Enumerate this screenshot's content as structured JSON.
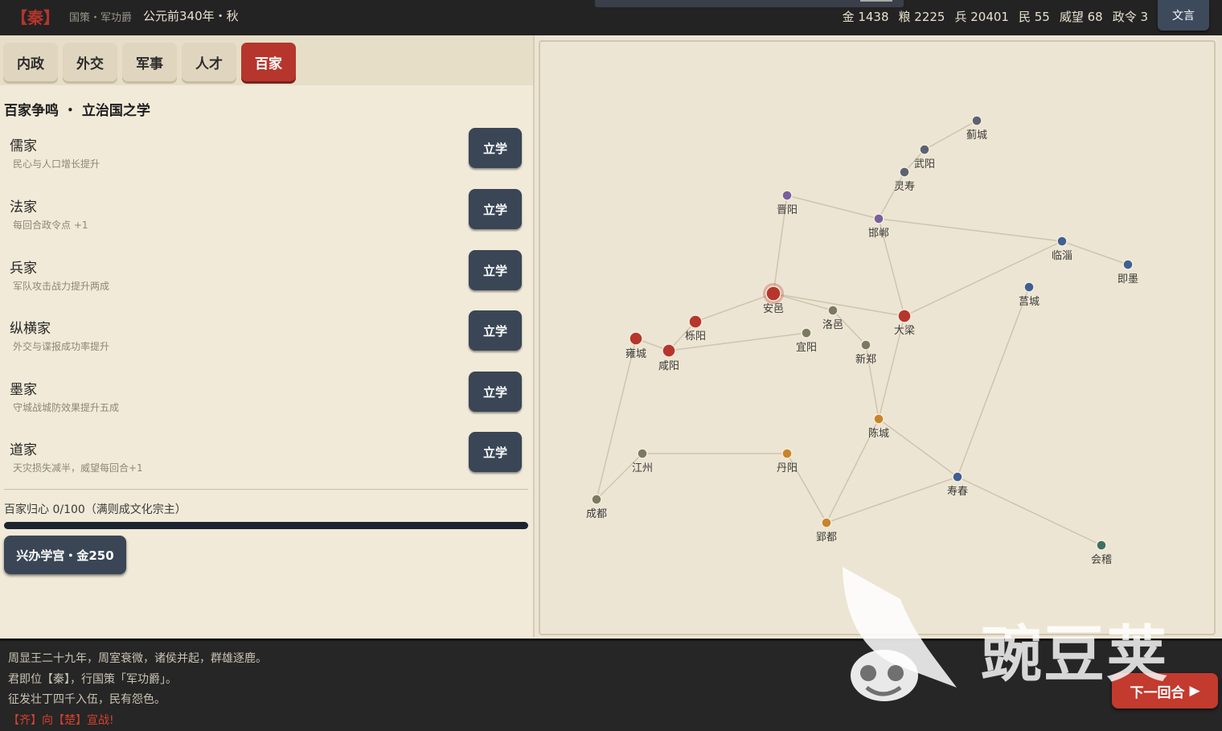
{
  "topbar": {
    "state": "【秦】",
    "policy": "国策・军功爵",
    "date": "公元前340年・秋",
    "stats": [
      "金 1438",
      "粮 2225",
      "兵 20401",
      "民 55",
      "威望 68",
      "政令 3"
    ],
    "wenyan_button": "文言"
  },
  "tabs": [
    {
      "label": "内政",
      "active": false
    },
    {
      "label": "外交",
      "active": false
    },
    {
      "label": "军事",
      "active": false
    },
    {
      "label": "人才",
      "active": false
    },
    {
      "label": "百家",
      "active": true
    }
  ],
  "section_title": "百家争鸣 ・ 立治国之学",
  "schools": [
    {
      "name": "儒家",
      "desc": "民心与人口增长提升",
      "button": "立学"
    },
    {
      "name": "法家",
      "desc": "每回合政令点 +1",
      "button": "立学"
    },
    {
      "name": "兵家",
      "desc": "军队攻击战力提升两成",
      "button": "立学"
    },
    {
      "name": "纵横家",
      "desc": "外交与谍报成功率提升",
      "button": "立学"
    },
    {
      "name": "墨家",
      "desc": "守城战城防效果提升五成",
      "button": "立学"
    },
    {
      "name": "道家",
      "desc": "天灾损失减半，威望每回合+1",
      "button": "立学"
    }
  ],
  "progress": {
    "label": "百家归心 0/100（满则成文化宗主）",
    "value": 0,
    "max": 100
  },
  "build_button": "兴办学宫・金250",
  "map": {
    "colors": {
      "qin": "#b6362d",
      "jin": "#7a5fa0",
      "qi": "#3f5f94",
      "chu": "#c8842a",
      "yan": "#5c6272",
      "neutral": "#7a7a62",
      "yue": "#3f6f66",
      "road": "#cfc4ad"
    },
    "cities": [
      {
        "id": "jicheng",
        "name": "蓟城",
        "owner": "yan"
      },
      {
        "id": "wuyang",
        "name": "武阳",
        "owner": "yan"
      },
      {
        "id": "lingshou",
        "name": "灵寿",
        "owner": "yan"
      },
      {
        "id": "jinyang",
        "name": "晋阳",
        "owner": "jin"
      },
      {
        "id": "handan",
        "name": "邯郸",
        "owner": "jin"
      },
      {
        "id": "linzi",
        "name": "临淄",
        "owner": "qi"
      },
      {
        "id": "jimo",
        "name": "即墨",
        "owner": "qi"
      },
      {
        "id": "jucheng",
        "name": "莒城",
        "owner": "qi"
      },
      {
        "id": "anyi",
        "name": "安邑",
        "owner": "qin",
        "capital": true
      },
      {
        "id": "luoyi",
        "name": "洛邑",
        "owner": "neutral"
      },
      {
        "id": "daliang",
        "name": "大梁",
        "owner": "qin"
      },
      {
        "id": "yueyang",
        "name": "栎阳",
        "owner": "qin"
      },
      {
        "id": "yongcheng",
        "name": "雍城",
        "owner": "qin"
      },
      {
        "id": "xianyang",
        "name": "咸阳",
        "owner": "qin"
      },
      {
        "id": "yiyang",
        "name": "宜阳",
        "owner": "neutral"
      },
      {
        "id": "xinzheng",
        "name": "新郑",
        "owner": "neutral"
      },
      {
        "id": "chencheng",
        "name": "陈城",
        "owner": "chu"
      },
      {
        "id": "jiangzhou",
        "name": "江州",
        "owner": "neutral"
      },
      {
        "id": "danyang",
        "name": "丹阳",
        "owner": "chu"
      },
      {
        "id": "chengdu",
        "name": "成都",
        "owner": "neutral"
      },
      {
        "id": "shouchun",
        "name": "寿春",
        "owner": "qi"
      },
      {
        "id": "yingdu",
        "name": "郢都",
        "owner": "chu"
      },
      {
        "id": "kuaiji",
        "name": "会稽",
        "owner": "yue"
      }
    ],
    "roads": [
      [
        "jicheng",
        "wuyang"
      ],
      [
        "wuyang",
        "lingshou"
      ],
      [
        "lingshou",
        "handan"
      ],
      [
        "jinyang",
        "handan"
      ],
      [
        "jinyang",
        "anyi"
      ],
      [
        "handan",
        "linzi"
      ],
      [
        "handan",
        "daliang"
      ],
      [
        "linzi",
        "jimo"
      ],
      [
        "linzi",
        "daliang"
      ],
      [
        "anyi",
        "daliang"
      ],
      [
        "anyi",
        "luoyi"
      ],
      [
        "anyi",
        "yueyang"
      ],
      [
        "yueyang",
        "xianyang"
      ],
      [
        "yongcheng",
        "xianyang"
      ],
      [
        "xianyang",
        "yiyang"
      ],
      [
        "luoyi",
        "xinzheng"
      ],
      [
        "daliang",
        "chencheng"
      ],
      [
        "xinzheng",
        "chencheng"
      ],
      [
        "yongcheng",
        "chengdu"
      ],
      [
        "chengdu",
        "jiangzhou"
      ],
      [
        "jiangzhou",
        "danyang"
      ],
      [
        "danyang",
        "yingdu"
      ],
      [
        "chencheng",
        "yingdu"
      ],
      [
        "chencheng",
        "shouchun"
      ],
      [
        "yingdu",
        "shouchun"
      ],
      [
        "jucheng",
        "shouchun"
      ],
      [
        "shouchun",
        "kuaiji"
      ]
    ]
  },
  "log": [
    {
      "text": "周显王二十九年，周室衰微，诸侯并起，群雄逐鹿。",
      "type": "normal"
    },
    {
      "text": "君即位【秦】，行国策「军功爵」。",
      "type": "normal"
    },
    {
      "text": "征发壮丁四千入伍，民有怨色。",
      "type": "normal"
    },
    {
      "text": "【齐】向【楚】宣战!",
      "type": "war"
    }
  ],
  "next_turn_button": "下一回合",
  "watermark": "豌豆荚"
}
